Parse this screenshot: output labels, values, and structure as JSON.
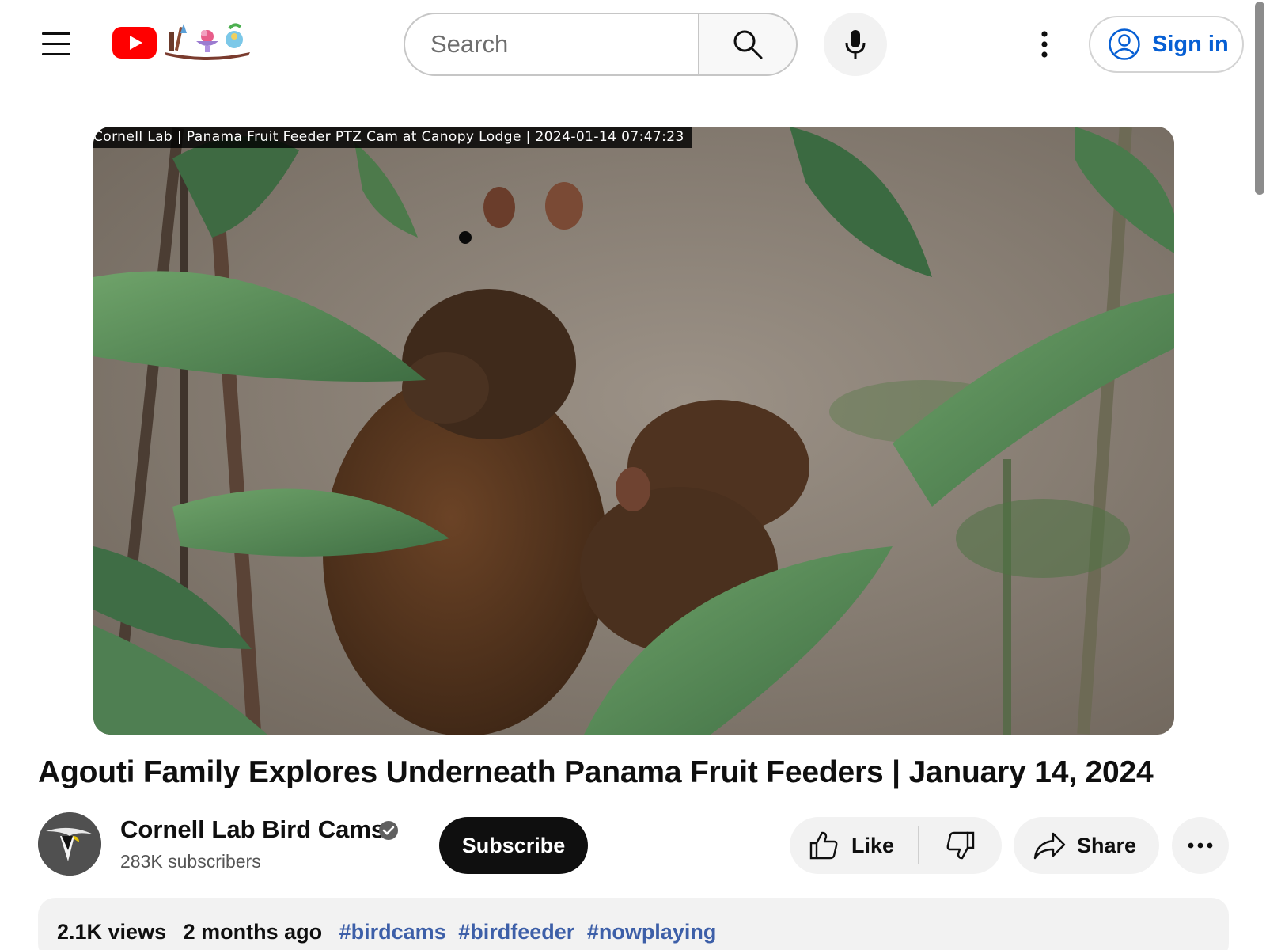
{
  "header": {
    "search_placeholder": "Search",
    "sign_in_label": "Sign in",
    "icons": [
      "menu-icon",
      "youtube-logo",
      "search-icon",
      "mic-icon",
      "more-vert-icon",
      "account-icon"
    ]
  },
  "video": {
    "overlay_text": "Cornell Lab | Panama Fruit Feeder PTZ Cam at Canopy Lodge | 2024-01-14  07:47:23",
    "title": "Agouti Family Explores Underneath Panama Fruit Feeders | January 14, 2024"
  },
  "channel": {
    "name": "Cornell Lab Bird Cams",
    "subscribers": "283K subscribers",
    "subscribe_label": "Subscribe"
  },
  "actions": {
    "like_label": "Like",
    "share_label": "Share"
  },
  "description": {
    "views": "2.1K views",
    "age": "2 months ago",
    "hashtags": [
      "#birdcams",
      "#birdfeeder",
      "#nowplaying"
    ]
  },
  "colors": {
    "brand_red": "#ff0000",
    "link_blue": "#065fd4",
    "chip_bg": "#f2f2f2"
  }
}
